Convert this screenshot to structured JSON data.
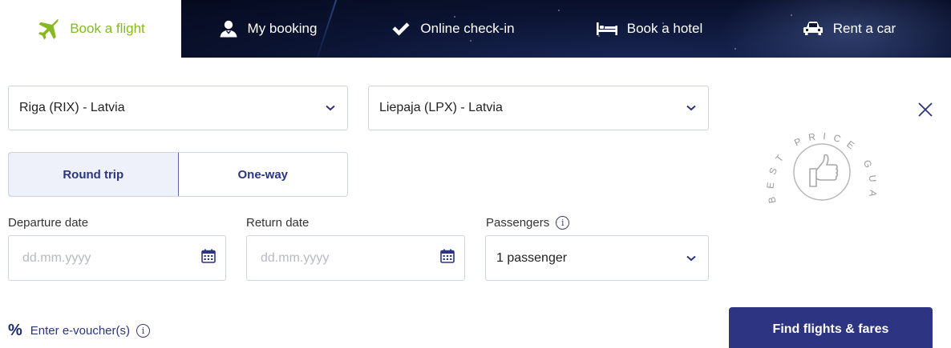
{
  "tabs": [
    {
      "label": "Book a flight",
      "icon": "airplane-icon",
      "active": true
    },
    {
      "label": "My booking",
      "icon": "user-icon",
      "active": false
    },
    {
      "label": "Online check-in",
      "icon": "checkmark-icon",
      "active": false
    },
    {
      "label": "Book a hotel",
      "icon": "bed-icon",
      "active": false
    },
    {
      "label": "Rent a car",
      "icon": "car-icon",
      "active": false
    }
  ],
  "form": {
    "origin": "Riga (RIX) - Latvia",
    "destination": "Liepaja (LPX) - Latvia",
    "trip_type": {
      "options": [
        "Round trip",
        "One-way"
      ],
      "selected": "Round trip"
    },
    "departure": {
      "label": "Departure date",
      "placeholder": "dd.mm.yyyy"
    },
    "return": {
      "label": "Return date",
      "placeholder": "dd.mm.yyyy"
    },
    "passengers": {
      "label": "Passengers",
      "value": "1 passenger"
    },
    "voucher": {
      "symbol": "%",
      "label": "Enter e-voucher(s)"
    },
    "submit_label": "Find flights & fares"
  },
  "stamp": {
    "text": "BEST PRICE GUARANTEE",
    "icon": "thumbs-up-icon"
  },
  "colors": {
    "accent_green": "#86b820",
    "primary_navy": "#2d3481",
    "border": "#cfd3de"
  }
}
